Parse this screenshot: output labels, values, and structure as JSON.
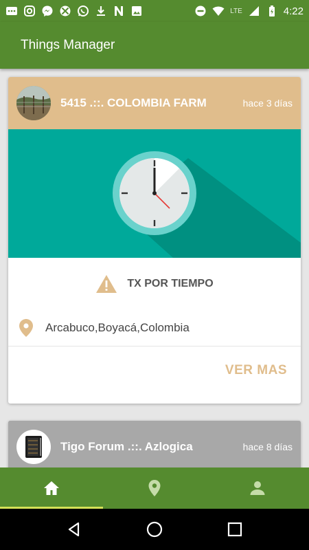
{
  "status_bar": {
    "time": "4:22",
    "network": "LTE",
    "icons": [
      "message-icon",
      "instagram-icon",
      "messenger-icon",
      "xbox-icon",
      "whatsapp-icon",
      "download-icon",
      "news-icon",
      "image-icon",
      "do-not-disturb-icon",
      "wifi-icon",
      "signal-icon",
      "battery-icon"
    ]
  },
  "app_bar": {
    "title": "Things Manager"
  },
  "cards": [
    {
      "title": "5415 .::. COLOMBIA FARM",
      "time": "hace 3 días",
      "header_color": "#e0bd8c",
      "banner_color": "#00a99a",
      "banner_icon": "clock-icon",
      "alert_icon": "warning-icon",
      "alert": "TX POR TIEMPO",
      "location_icon": "location-pin-icon",
      "location": "Arcabuco,Boyacá,Colombia",
      "action": "VER MAS"
    },
    {
      "title": "Tigo Forum .::. Azlogica",
      "time": "hace 8 días",
      "header_color": "#a8a8a8"
    }
  ],
  "bottom_nav": {
    "items": [
      {
        "icon": "home-icon",
        "active": true
      },
      {
        "icon": "location-pin-icon",
        "active": false
      },
      {
        "icon": "person-icon",
        "active": false
      }
    ],
    "accent": "#d4e157"
  },
  "system_nav": {
    "icons": [
      "back-icon",
      "home-circle-icon",
      "recents-icon"
    ]
  },
  "colors": {
    "primary": "#558b2f",
    "accent_tan": "#e0bd8c",
    "teal": "#00a99a"
  }
}
